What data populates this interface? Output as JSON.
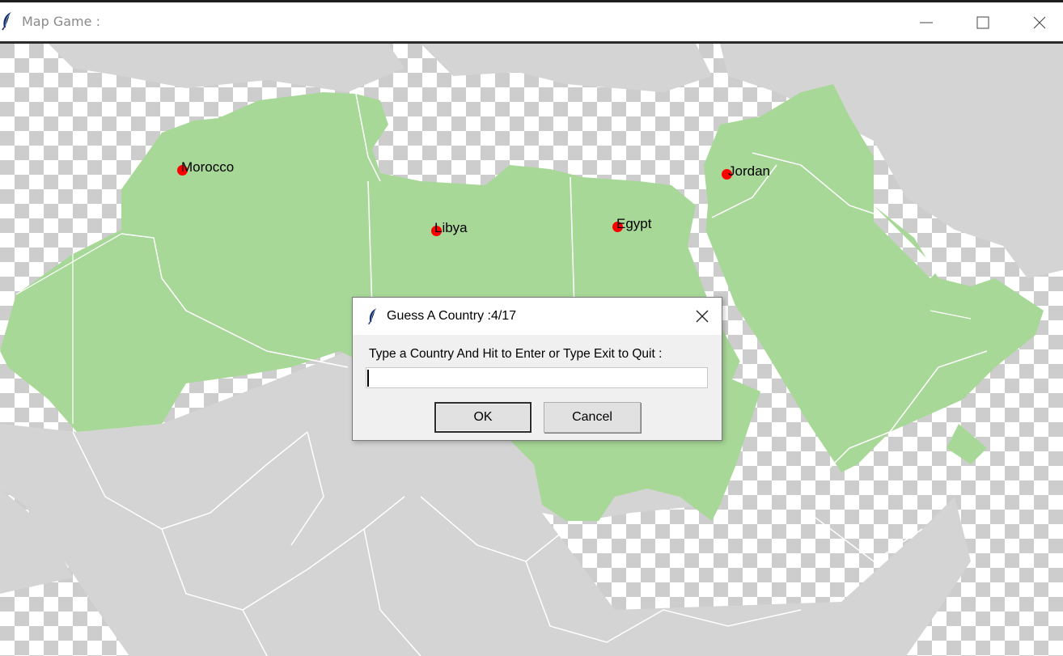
{
  "window": {
    "title": "Map Game :",
    "icon": "feather-icon",
    "controls": [
      "minimize-icon",
      "maximize-icon",
      "close-icon"
    ]
  },
  "map": {
    "labels": [
      {
        "name": "Morocco"
      },
      {
        "name": "Libya"
      },
      {
        "name": "Egypt"
      },
      {
        "name": "Jordan"
      }
    ],
    "colors": {
      "guessed": "#a8d898",
      "land": "#d4d4d4",
      "border": "#ffffff",
      "marker": "#ff0000"
    }
  },
  "dialog": {
    "title": "Guess A Country :4/17",
    "prompt": "Type a Country And Hit to Enter or Type Exit to Quit :",
    "input_value": "",
    "ok_label": "OK",
    "cancel_label": "Cancel"
  }
}
